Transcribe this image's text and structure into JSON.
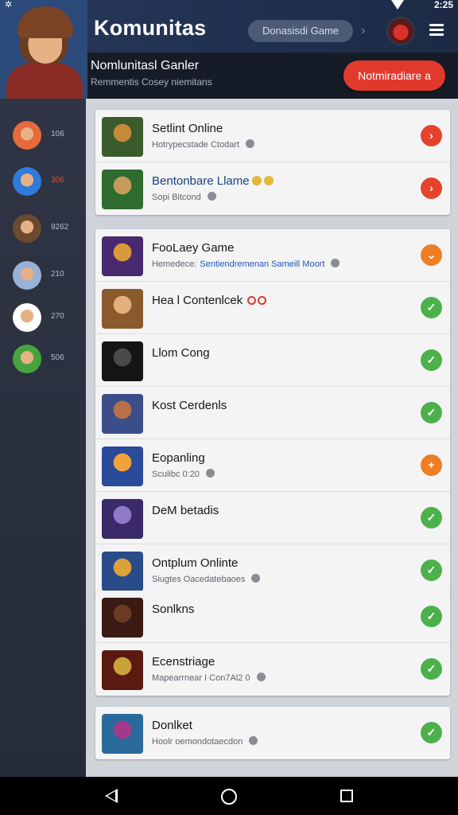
{
  "status": {
    "time": "2:25"
  },
  "header": {
    "title": "Komunitas",
    "search_label": "Donasisdi Game",
    "icons": [
      "avatar",
      "chevron-right-icon",
      "profile-icon",
      "menu-icon"
    ]
  },
  "banner": {
    "title": "Nomlunitasl Ganler",
    "subtitle": "Remmentis Cosey niemitans",
    "button": "Notmiradiare a"
  },
  "sidebar": {
    "items": [
      {
        "count": "106",
        "color": "#e76a3c"
      },
      {
        "count": "306",
        "color": "#2f7bd9",
        "highlight": true
      },
      {
        "count": "9262",
        "color": "#6b4a30"
      },
      {
        "count": "210",
        "color": "#9ab1d6"
      },
      {
        "count": "270",
        "color": "#ffffff"
      },
      {
        "count": "506",
        "color": "#46a43f"
      }
    ]
  },
  "cards": [
    {
      "rows": [
        {
          "title": "Setlint Online",
          "subtitle": "Hotrypecstade Ctodart",
          "status": "red",
          "status_icon": "arrow-right-icon",
          "icon_colors": [
            "#3b5b2a",
            "#c28a39"
          ]
        },
        {
          "title": "Bentonbare Llame",
          "subtitle": "Sopi Bitcond",
          "status": "red",
          "status_icon": "arrow-right-icon",
          "title_blue": true,
          "coins": true,
          "icon_colors": [
            "#2e6b2f",
            "#c59b5a"
          ]
        }
      ]
    },
    {
      "rows": [
        {
          "title": "FooLaey Game",
          "subtitle_prefix": "Hemedece:",
          "subtitle_link": "Sentiendremenan Sameill Moort",
          "status": "orange",
          "status_icon": "chevron-down-icon",
          "icon_colors": [
            "#4a2a6e",
            "#d99a3c"
          ]
        },
        {
          "title": "Hea l Contenlcek",
          "subtitle": "",
          "status": "green",
          "status_icon": "check-icon",
          "rings": true,
          "icon_colors": [
            "#8a5a2c",
            "#e2b07a"
          ]
        },
        {
          "title": "Llom Cong",
          "subtitle": "",
          "status": "green",
          "status_icon": "check-icon",
          "icon_colors": [
            "#151515",
            "#4a4a4a"
          ]
        },
        {
          "title": "Kost Cerdenls",
          "subtitle": "",
          "status": "green",
          "status_icon": "check-icon",
          "icon_colors": [
            "#3b4e8a",
            "#b9714a"
          ]
        },
        {
          "title": "Eopanling",
          "subtitle": "Sculibc 0:20",
          "status": "orange",
          "status_icon": "plus-icon",
          "icon_colors": [
            "#2a4a9a",
            "#f2a23a"
          ]
        },
        {
          "title": "DeM betadis",
          "subtitle": "",
          "status": "green",
          "status_icon": "check-icon",
          "icon_colors": [
            "#3a2a6a",
            "#8f7ac9"
          ]
        },
        {
          "title": "Ontplum Onlinte",
          "subtitle": "Siugtes Oacedatebaoes",
          "status": "green",
          "status_icon": "check-icon",
          "icon_colors": [
            "#2a4b8a",
            "#d9a23a"
          ]
        }
      ]
    },
    {
      "rows": [
        {
          "title": "Sonlkns",
          "subtitle": "",
          "status": "green",
          "status_icon": "check-icon",
          "icon_colors": [
            "#3a1a12",
            "#6b3a22"
          ]
        },
        {
          "title": "Ecenstriage",
          "subtitle": "Mapearrnear I Con7Al2 0",
          "status": "green",
          "status_icon": "check-icon",
          "icon_colors": [
            "#5a1a12",
            "#c9a23a"
          ]
        }
      ]
    },
    {
      "rows": [
        {
          "title": "Donlket",
          "subtitle": "Hoolr oemondotaecdon",
          "status": "green",
          "status_icon": "check-icon",
          "icon_colors": [
            "#2a6a9a",
            "#a23a8a"
          ]
        }
      ]
    }
  ]
}
